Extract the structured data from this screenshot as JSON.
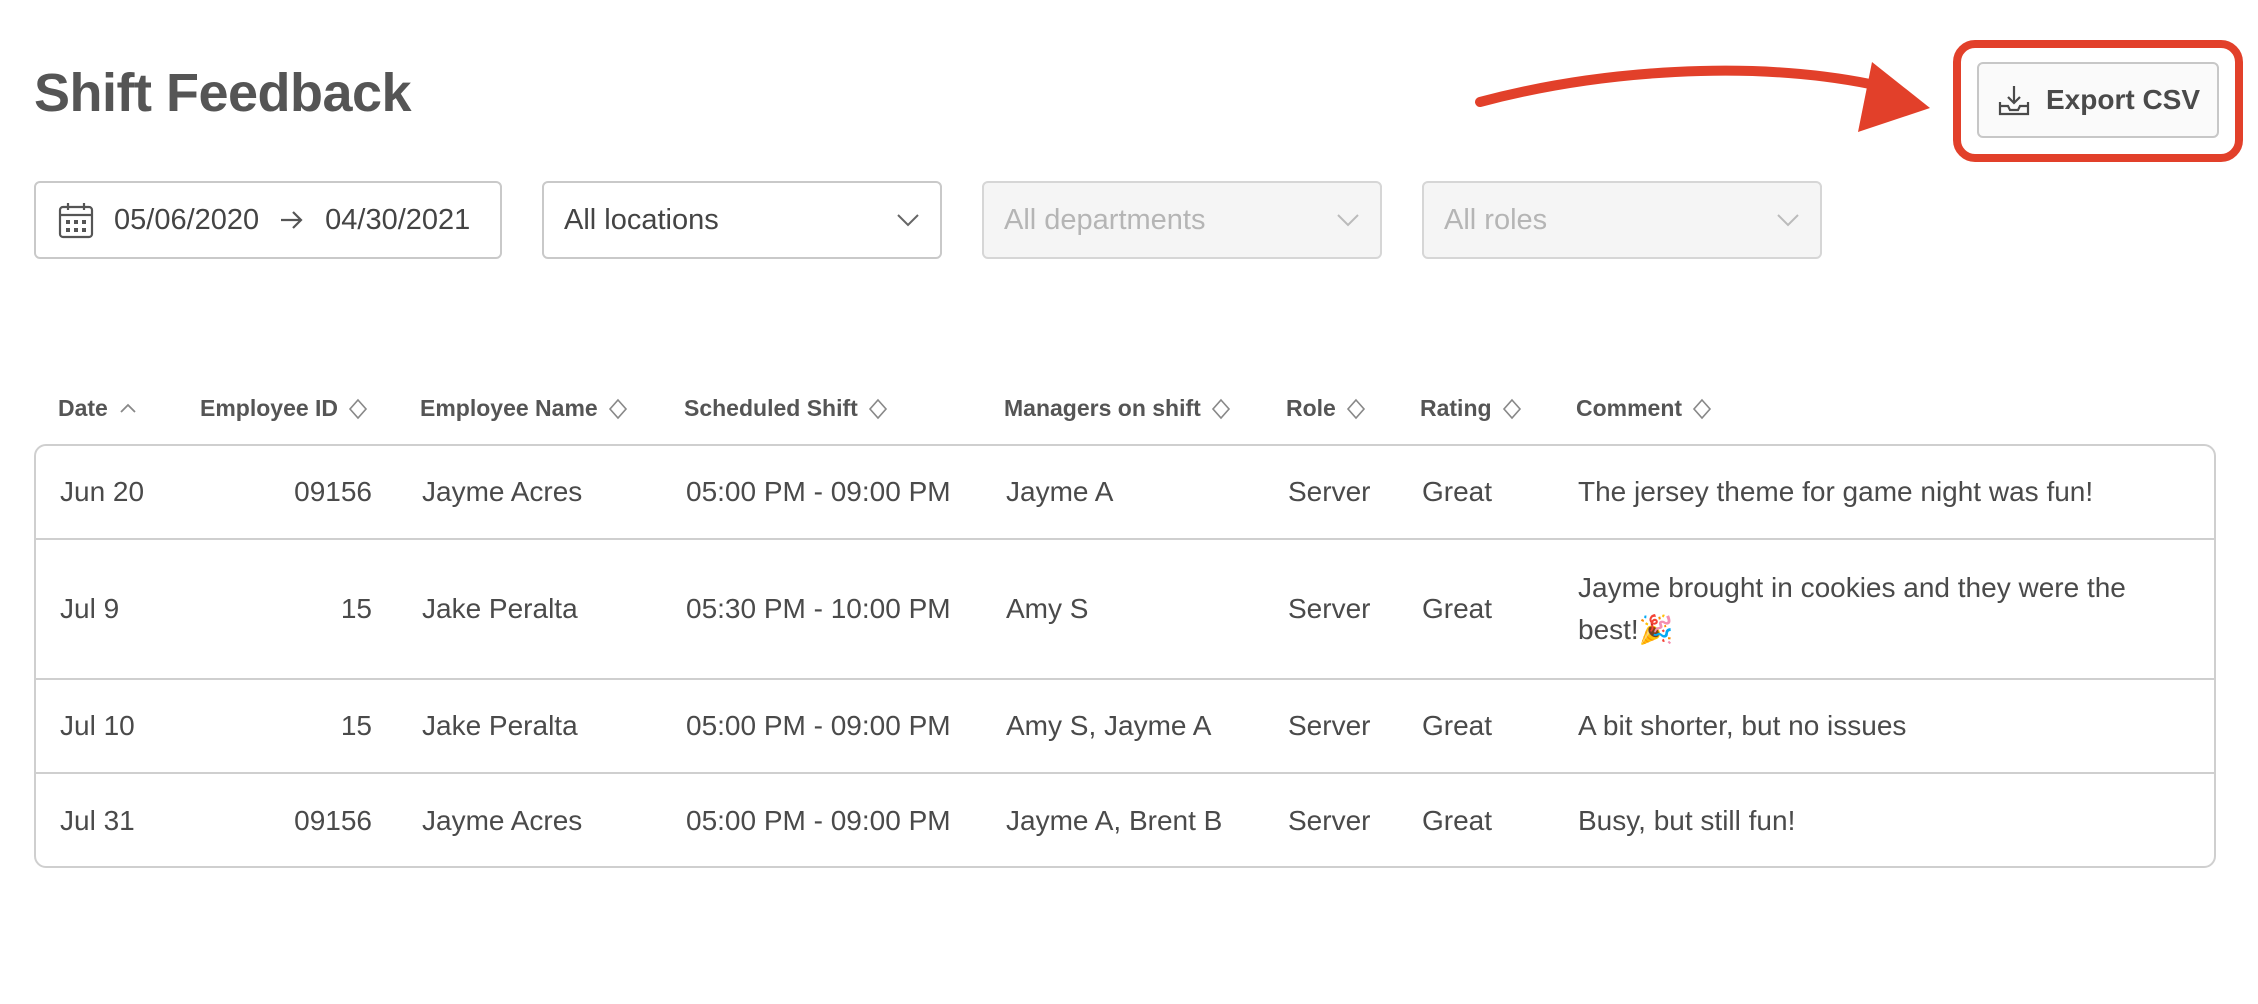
{
  "page": {
    "title": "Shift Feedback"
  },
  "toolbar": {
    "export_label": "Export CSV",
    "export_icon": "download-tray-icon"
  },
  "filters": {
    "date_start": "05/06/2020",
    "date_end": "04/30/2021",
    "location": "All locations",
    "department_placeholder": "All departments",
    "role_placeholder": "All roles"
  },
  "table": {
    "columns": [
      {
        "label": "Date",
        "sort": "ascending"
      },
      {
        "label": "Employee ID",
        "sort": "none"
      },
      {
        "label": "Employee Name",
        "sort": "none"
      },
      {
        "label": "Scheduled Shift",
        "sort": "none"
      },
      {
        "label": "Managers on shift",
        "sort": "none"
      },
      {
        "label": "Role",
        "sort": "none"
      },
      {
        "label": "Rating",
        "sort": "none"
      },
      {
        "label": "Comment",
        "sort": "none"
      }
    ],
    "rows": [
      {
        "date": "Jun 20",
        "employee_id": "09156",
        "name": "Jayme Acres",
        "shift": "05:00 PM - 09:00 PM",
        "managers": "Jayme A",
        "role": "Server",
        "rating": "Great",
        "comment": "The jersey theme for game night was fun!"
      },
      {
        "date": "Jul 9",
        "employee_id": "15",
        "name": "Jake Peralta",
        "shift": "05:30 PM - 10:00 PM",
        "managers": "Amy S",
        "role": "Server",
        "rating": "Great",
        "comment": "Jayme brought in cookies and they were the best!🎉"
      },
      {
        "date": "Jul 10",
        "employee_id": "15",
        "name": "Jake Peralta",
        "shift": "05:00 PM - 09:00 PM",
        "managers": "Amy S, Jayme A",
        "role": "Server",
        "rating": "Great",
        "comment": "A bit shorter, but no issues"
      },
      {
        "date": "Jul 31",
        "employee_id": "09156",
        "name": "Jayme Acres",
        "shift": "05:00 PM - 09:00 PM",
        "managers": "Jayme A, Brent B",
        "role": "Server",
        "rating": "Great",
        "comment": "Busy, but still fun!"
      }
    ]
  },
  "colors": {
    "annotation": "#e2402a",
    "border": "#cfcfcf",
    "text": "#4a4a4a"
  }
}
